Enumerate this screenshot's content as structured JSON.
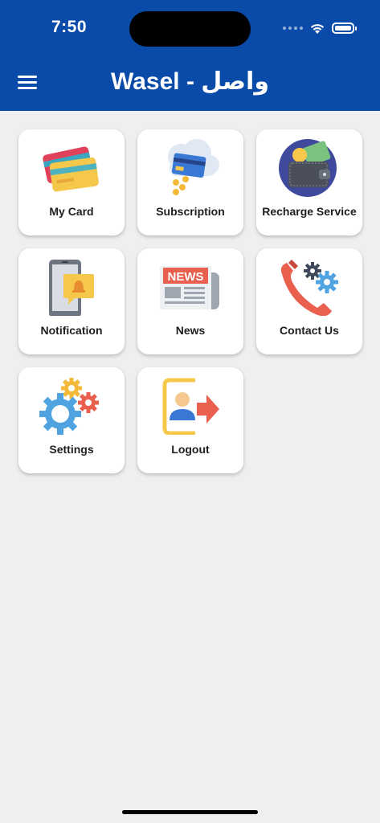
{
  "status_bar": {
    "time": "7:50"
  },
  "header": {
    "title": "Wasel - واصل",
    "menu_icon": "hamburger-menu-icon",
    "background": "#0a4aa8"
  },
  "tiles": [
    {
      "label": "My Card",
      "icon": "credit-cards-icon"
    },
    {
      "label": "Subscription",
      "icon": "cloud-card-subscription-icon"
    },
    {
      "label": "Recharge Service",
      "icon": "wallet-recharge-icon"
    },
    {
      "label": "Notification",
      "icon": "phone-notification-icon"
    },
    {
      "label": "News",
      "icon": "newspaper-icon"
    },
    {
      "label": "Contact Us",
      "icon": "phone-gears-contact-icon"
    },
    {
      "label": "Settings",
      "icon": "gears-settings-icon"
    },
    {
      "label": "Logout",
      "icon": "logout-user-arrow-icon"
    }
  ]
}
